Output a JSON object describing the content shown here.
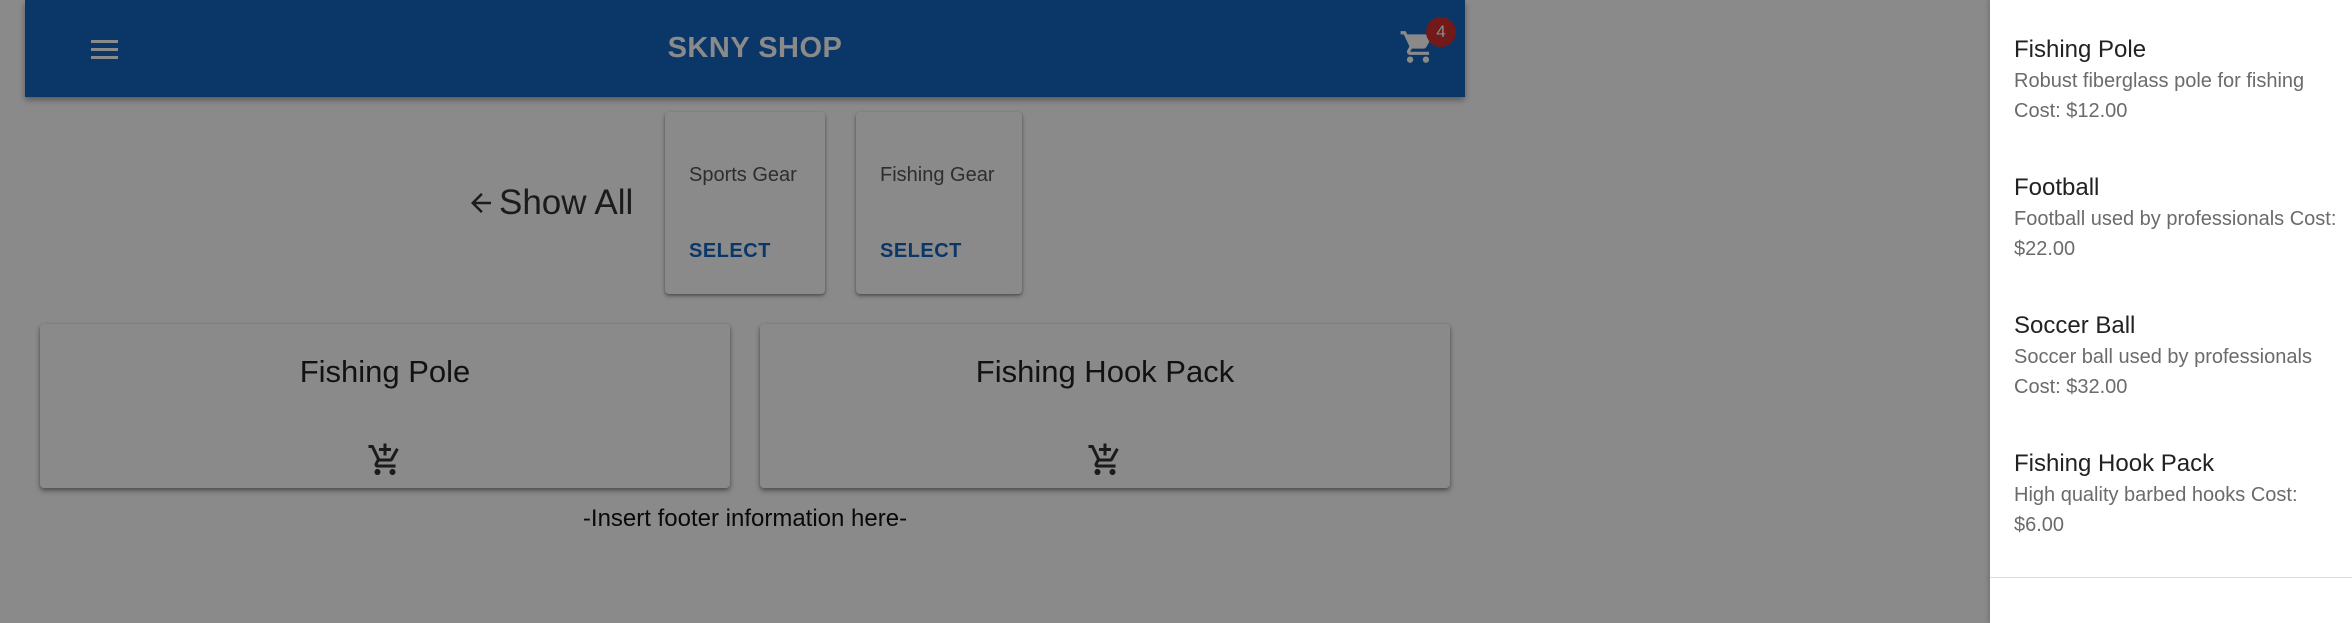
{
  "header": {
    "title": "SKNY SHOP",
    "cart_count": "4"
  },
  "nav": {
    "show_all": "Show All"
  },
  "categories": [
    {
      "name": "Sports Gear",
      "action": "SELECT"
    },
    {
      "name": "Fishing Gear",
      "action": "SELECT"
    }
  ],
  "products": [
    {
      "title": "Fishing Pole"
    },
    {
      "title": "Fishing Hook Pack"
    }
  ],
  "footer": {
    "text": "-Insert footer information here-"
  },
  "drawer": {
    "items": [
      {
        "title": "Fishing Pole",
        "desc": "Robust fiberglass pole for fishing Cost: $12.00"
      },
      {
        "title": "Football",
        "desc": "Football used by professionals Cost: $22.00"
      },
      {
        "title": "Soccer Ball",
        "desc": "Soccer ball used by professionals Cost: $32.00"
      },
      {
        "title": "Fishing Hook Pack",
        "desc": "High quality barbed hooks Cost: $6.00"
      }
    ]
  },
  "colors": {
    "appbar": "#1565c0",
    "badge": "#d32f2f",
    "accent": "#1565c0"
  }
}
